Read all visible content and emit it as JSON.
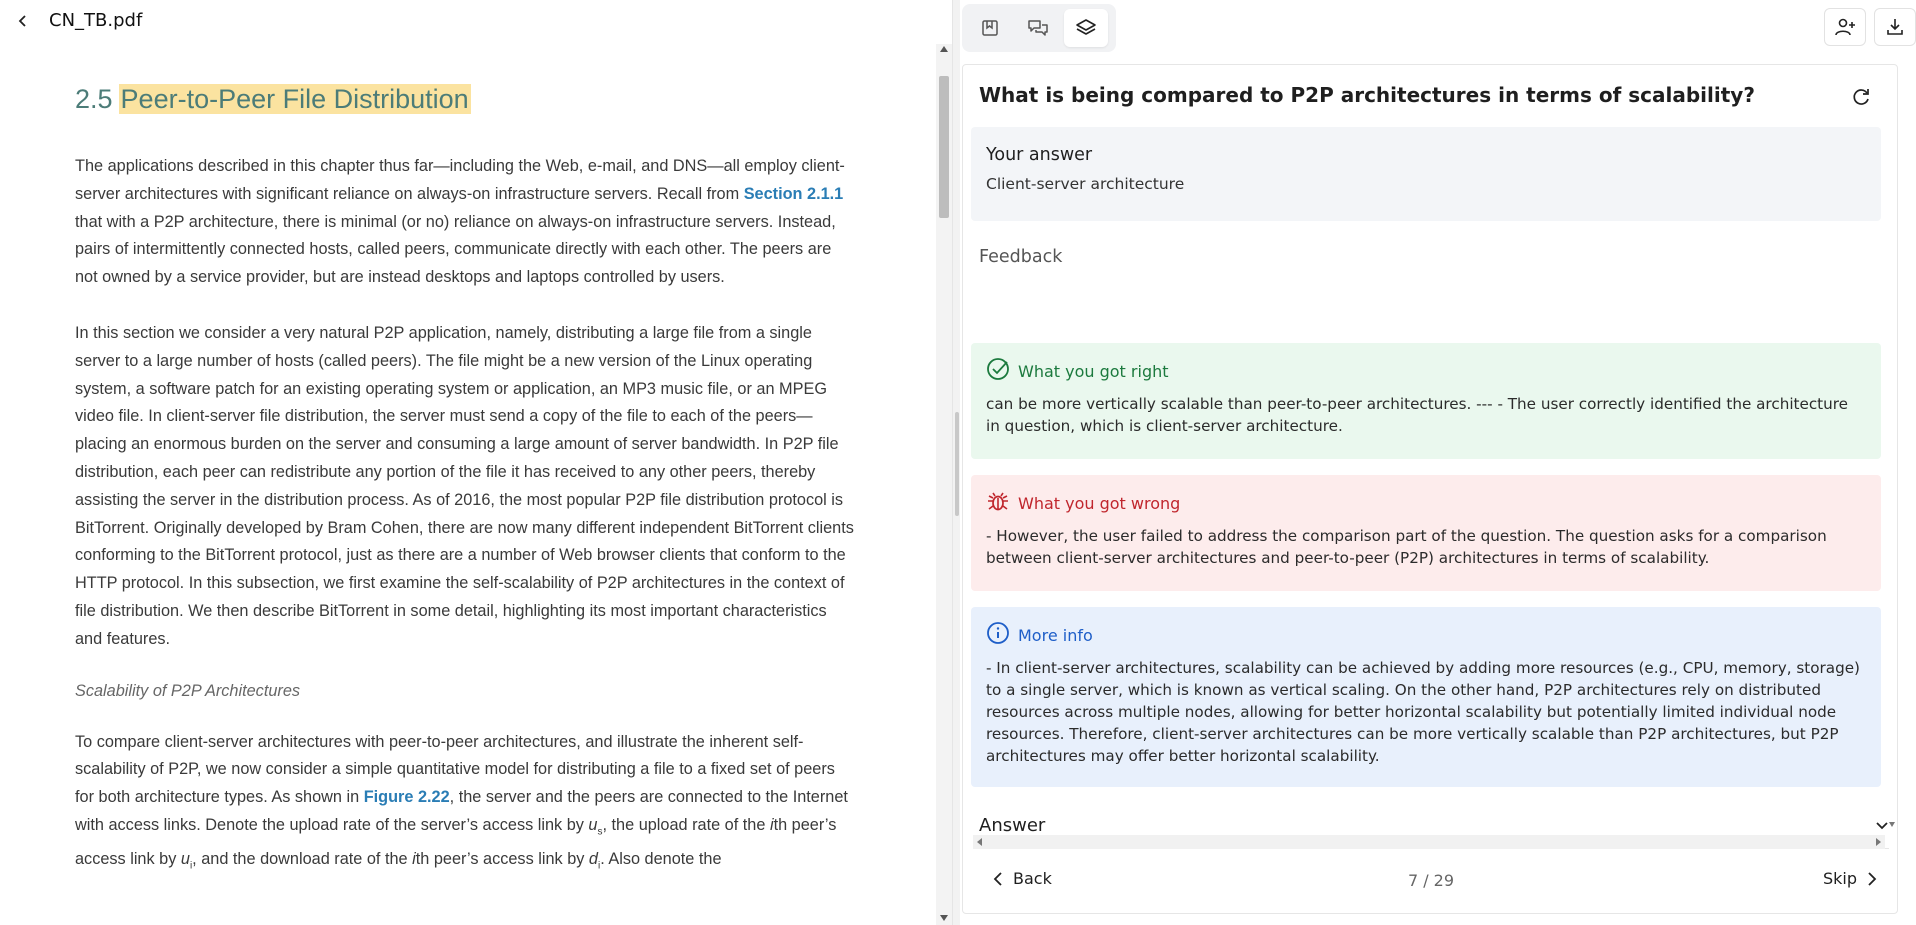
{
  "file": {
    "title": "CN_TB.pdf"
  },
  "pdf": {
    "section_number": "2.5",
    "section_title": "Peer-to-Peer File Distribution",
    "p1_a": "The applications described in this chapter thus far—including the Web, e-mail, and DNS—all employ client-server architectures with significant reliance on always-on infrastructure servers. Recall from ",
    "p1_link": "Section 2.1.1",
    "p1_b": " that with a P2P architecture, there is minimal (or no) reliance on always-on infrastructure servers. Instead, pairs of intermittently connected hosts, called peers, communicate directly with each other. The peers are not owned by a service provider, but are instead desktops and laptops controlled by users.",
    "p2": "In this section we consider a very natural P2P application, namely, distributing a large file from a single server to a large number of hosts (called peers). The file might be a new version of the Linux operating system, a software patch for an existing operating system or application, an MP3 music file, or an MPEG video file. In client-server file distribution, the server must send a copy of the file to each of the peers—placing an enormous burden on the server and consuming a large amount of server bandwidth. In P2P file distribution, each peer can redistribute any portion of the file it has received to any other peers, thereby assisting the server in the distribution process. As of 2016, the most popular P2P file distribution protocol is BitTorrent. Originally developed by Bram Cohen, there are now many different independent BitTorrent clients conforming to the BitTorrent protocol, just as there are a number of Web browser clients that conform to the HTTP protocol. In this subsection, we first examine the self-scalability of P2P architectures in the context of file distribution. We then describe BitTorrent in some detail, highlighting its most important characteristics and features.",
    "subheading": "Scalability of P2P Architectures",
    "p3_a": "To compare client-server architectures with peer-to-peer architectures, and illustrate the inherent self-scalability of P2P, we now consider a simple quantitative model for distributing a file to a fixed set of peers for both architecture types. As shown in ",
    "p3_link": "Figure 2.22",
    "p3_b": ", the server and the peers are connected to the Internet with access links. Denote the upload rate of the server’s access link by ",
    "p3_us": "u",
    "p3_us_sub": "s",
    "p3_c": ", the upload rate of the ",
    "p3_i1": "i",
    "p3_d": "th peer’s access link by ",
    "p3_ui": "u",
    "p3_ui_sub": "i",
    "p3_e": ", and the download rate of the ",
    "p3_i2": "i",
    "p3_f": "th peer’s access link by ",
    "p3_di": "d",
    "p3_di_sub": "i",
    "p3_g": ". Also denote the"
  },
  "quiz": {
    "question": "What is being compared to P2P architectures in terms of scalability?",
    "your_answer_heading": "Your answer",
    "your_answer": "Client-server architecture",
    "feedback_label": "Feedback",
    "right_heading": "What you got right",
    "right_text": "can be more vertically scalable than peer-to-peer architectures. --- - The user correctly identified the architecture in question, which is client-server architecture.",
    "wrong_heading": "What you got wrong",
    "wrong_text": "- However, the user failed to address the comparison part of the question. The question asks for a comparison between client-server architectures and peer-to-peer (P2P) architectures in terms of scalability.",
    "info_heading": "More info",
    "info_text": "- In client-server architectures, scalability can be achieved by adding more resources (e.g., CPU, memory, storage) to a single server, which is known as vertical scaling. On the other hand, P2P architectures rely on distributed resources across multiple nodes, allowing for better horizontal scalability but potentially limited individual node resources. Therefore, client-server architectures can be more vertically scalable than P2P architectures, but P2P architectures may offer better horizontal scalability.",
    "answer_label": "Answer",
    "back_label": "Back",
    "skip_label": "Skip",
    "counter": "7 / 29"
  },
  "colors": {
    "highlight": "#fbe3a0",
    "section_title": "#4c7c78",
    "link": "#2a7db5",
    "right_bg": "#eaf8ee",
    "wrong_bg": "#fdecec",
    "info_bg": "#e8f0fc"
  },
  "icons": {
    "back": "chevron-left-icon",
    "tool1": "bookmark-icon",
    "tool2": "chat-icon",
    "tool3": "layers-icon",
    "add_user": "add-user-icon",
    "download": "download-icon",
    "refresh": "refresh-icon",
    "right": "check-circle-icon",
    "wrong": "bug-icon",
    "info": "info-icon",
    "answer_toggle": "chevron-down-icon"
  }
}
